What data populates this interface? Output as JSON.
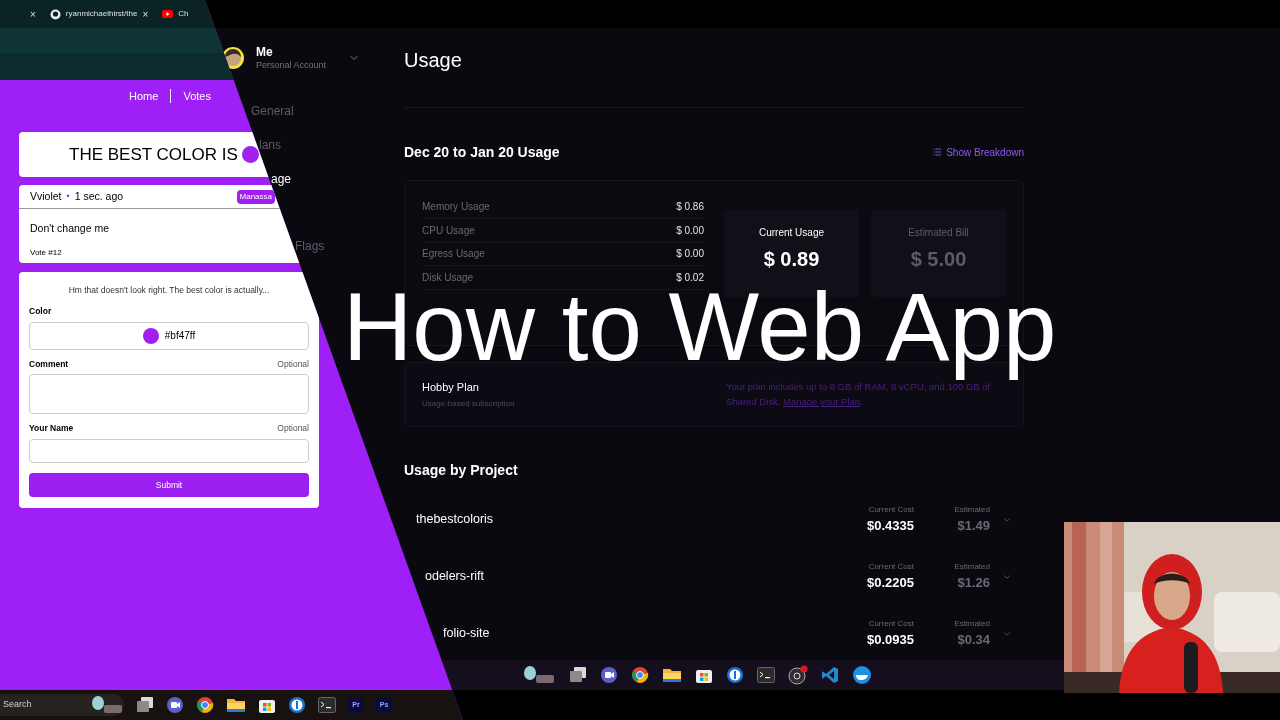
{
  "browser_tabs": [
    {
      "kind": "blank",
      "close": "×"
    },
    {
      "kind": "repo",
      "label": "ryanmichaelhirst/the",
      "close": "×"
    },
    {
      "kind": "video",
      "label": "Ch"
    }
  ],
  "site_nav": [
    "Home",
    "Votes"
  ],
  "hero": {
    "title": "THE BEST COLOR IS"
  },
  "vote": {
    "color_name": "Vviolet",
    "separator": "•",
    "time": "1 sec. ago",
    "location": "Manassa",
    "comment": "Don't change me",
    "number": "Vote #12"
  },
  "form": {
    "prompt": "Hm that doesn't look right. The best color is actually...",
    "fields": [
      {
        "kind": "color",
        "label": "Color",
        "value": "#bf47ff"
      },
      {
        "kind": "textarea",
        "label": "Comment",
        "hint": "Optional"
      },
      {
        "kind": "text",
        "label": "Your Name",
        "hint": "Optional"
      }
    ],
    "submit": "Submit"
  },
  "left_taskbar": {
    "search_placeholder": "Search",
    "app_labels": [
      "Pr",
      "Ps"
    ]
  },
  "account": {
    "name": "Me",
    "type": "Personal Account"
  },
  "sidebar": [
    {
      "label": "General",
      "selected": false
    },
    {
      "label": "lans",
      "selected": false
    },
    {
      "label": "age",
      "selected": true
    },
    {
      "label": "Flags",
      "selected": false
    }
  ],
  "page_title": "Usage",
  "period": "Dec 20 to Jan 20 Usage",
  "breakdown_link": "Show Breakdown",
  "usage_rows": [
    {
      "label": "Memory Usage",
      "value": "$ 0.86"
    },
    {
      "label": "CPU Usage",
      "value": "$ 0.00"
    },
    {
      "label": "Egress Usage",
      "value": "$ 0.00"
    },
    {
      "label": "Disk Usage",
      "value": "$ 0.02"
    }
  ],
  "current_usage": {
    "label": "Current Usage",
    "value": "$ 0.89"
  },
  "estimated_bill": {
    "label": "Estimated Bill",
    "value": "$ 5.00"
  },
  "plan": {
    "name": "Hobby Plan",
    "subtitle": "Usage-based subscription",
    "note": "Your plan includes up to 8 GB of RAM, 8 vCPU, and 100 GB of Shared Disk.",
    "link": "Manage your Plan",
    "note_end": "."
  },
  "projects_title": "Usage by Project",
  "projects": [
    {
      "name": "thebestcoloris",
      "cost_label": "Current Cost",
      "cost": "$0.4335",
      "estimate_label": "Estimated",
      "estimate": "$1.49"
    },
    {
      "name": "odelers-rift",
      "cost_label": "Current Cost",
      "cost": "$0.2205",
      "estimate_label": "Estimated",
      "estimate": "$1.26"
    },
    {
      "name": "folio-site",
      "cost_label": "Current Cost",
      "cost": "$0.0935",
      "estimate_label": "Estimated",
      "estimate": "$0.34"
    }
  ],
  "overlay_title": "How to Web App"
}
